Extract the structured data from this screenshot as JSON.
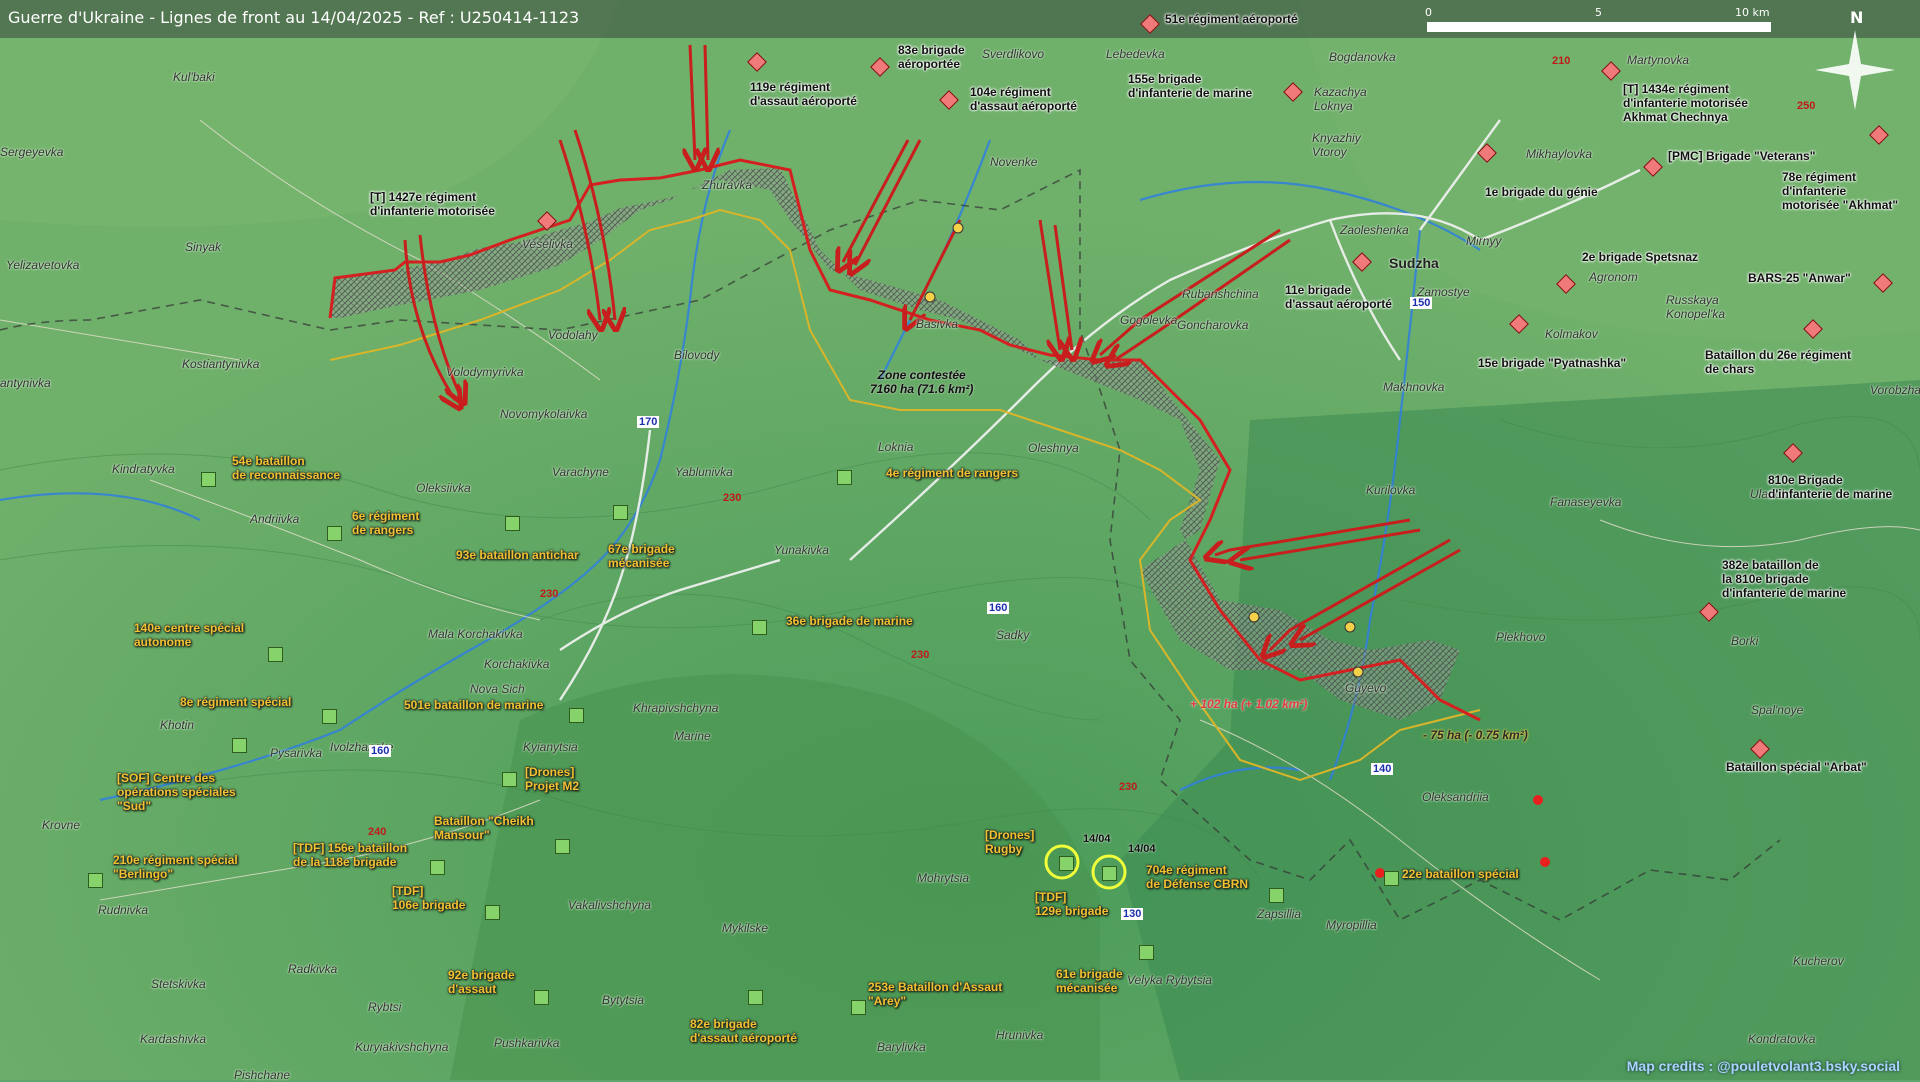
{
  "title": "Guerre d'Ukraine - Lignes de front au 14/04/2025 - Ref : U250414-1123",
  "scale": {
    "labels": [
      "0",
      "5",
      "10 km"
    ]
  },
  "compass": "N",
  "credits": "Map credits : @pouletvolant3.bsky.social",
  "zone": {
    "label": "Zone contestée\n7160 ha (71.6 km²)"
  },
  "deltas": {
    "gain": "+ 102 ha (+ 1.02 km²)",
    "loss": "- 75 ha (- 0.75 km²)"
  },
  "dates": [
    "14/04",
    "14/04"
  ],
  "roads_red": [
    "210",
    "250",
    "230",
    "230",
    "230",
    "240",
    "230"
  ],
  "roads_blue": [
    "150",
    "170",
    "160",
    "160",
    "140",
    "130"
  ],
  "places": [
    "Kul'baki",
    "Sergeyevka",
    "Sinyak",
    "Yelizavetovka",
    "Kostiantynivka",
    "antynivka",
    "Veselivka",
    "Zhuravka",
    "Vodolahy",
    "Volodymyrivka",
    "Bilovody",
    "Novomykolaivka",
    "Kindratyvka",
    "Varachyne",
    "Yablunivka",
    "Oleksiivka",
    "Andriivka",
    "Loknia",
    "Yunakivka",
    "Mala Korchakivka",
    "Korchakivka",
    "Nova Sich",
    "Khrapivshchyna",
    "Khotin",
    "Pysarivka",
    "Ivolzhanske",
    "Kyianytsia",
    "Marine",
    "Krovne",
    "Rudnivka",
    "Vakalivshchyna",
    "Mohrytsia",
    "Mykilske",
    "Stetskivka",
    "Radkivka",
    "Rybtsi",
    "Bytytsia",
    "Kardashivka",
    "Kuryiakivshchyna",
    "Pushkarivka",
    "Pishchane",
    "Barylivka",
    "Hrunivka",
    "Velyka Rybytsia",
    "Zapsillia",
    "Myropillia",
    "Oleksandriia",
    "Kucherov",
    "Kondratovka",
    "Spal'noye",
    "Borki",
    "Plekhovo",
    "Fanaseyevka",
    "Ulanok",
    "Vorobzha",
    "Guyevo",
    "Kurilovka",
    "Makhnovka",
    "Oleshnya",
    "Sadky",
    "Basivka",
    "Gogolevka",
    "Rubanshchina",
    "Goncharovka",
    "Novenke",
    "Sverdlikovo",
    "Lebedevka",
    "Bogdanovka",
    "Kazachya\nLoknya",
    "Knyazhiy\nVtoroy",
    "Zaoleshenka",
    "Zamostye",
    "Mirnyy",
    "Agronom",
    "Kolmakov",
    "Russkaya\nKonopel'ka",
    "Martynovka",
    "Mikhaylovka"
  ],
  "town_big": "Sudzha",
  "russian_units": [
    "51e régiment aéroporté",
    "83e brigade\naéroportée",
    "119e régiment\nd'assaut aéroporté",
    "104e régiment\nd'assaut aéroporté",
    "155e brigade\nd'infanterie de marine",
    "[T] 1434e régiment\nd'infanterie motorisée\nAkhmat Chechnya",
    "[PMC] Brigade \"Veterans\"",
    "78e régiment\nd'infanterie\nmotorisée \"Akhmat\"",
    "1e brigade du génie",
    "2e brigade Spetsnaz",
    "BARS-25 \"Anwar\"",
    "11e brigade\nd'assaut aéroporté",
    "15e brigade \"Pyatnashka\"",
    "Bataillon du 26e régiment\nde chars",
    "810e Brigade\nd'infanterie de marine",
    "382e bataillon de\nla 810e brigade\nd'infanterie de marine",
    "Bataillon spécial \"Arbat\"",
    "[T] 1427e régiment\nd'infanterie motorisée"
  ],
  "ukrainian_units": [
    "54e bataillon\nde reconnaissance",
    "6e régiment\nde rangers",
    "93e bataillon antichar",
    "67e brigade\nmécanisée",
    "4e régiment de rangers",
    "36e brigade de marine",
    "140e centre spécial\nautonome",
    "8e régiment spécial",
    "501e bataillon de marine",
    "[SOF] Centre des\nopérations spéciales\n\"Sud\"",
    "[Drones]\nProjet M2",
    "Bataillon \"Cheikh\nMansour\"",
    "210e régiment spécial\n\"Berlingo\"",
    "[TDF] 156e bataillon\nde la 118e brigade",
    "[TDF]\n106e brigade",
    "92e brigade\nd'assaut",
    "82e brigade\nd'assaut aéroporté",
    "253e Bataillon d'Assaut\n\"Arey\"",
    "61e brigade\nmécanisée",
    "[Drones]\nRugby",
    "[TDF]\n129e brigade",
    "704e régiment\nde Défense CBRN",
    "22e bataillon spécial"
  ],
  "colors": {
    "front_line": "#d42020",
    "ukraine_line": "#d9b52a",
    "zone_fill": "#8c9a8c",
    "water": "#2f7fe0",
    "road": "#f4f4f4"
  }
}
